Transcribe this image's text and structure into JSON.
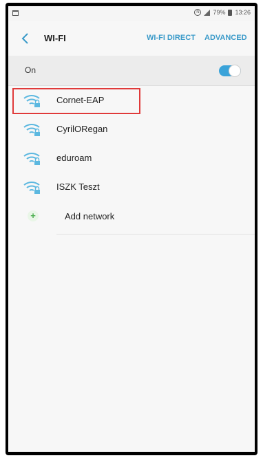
{
  "status": {
    "battery": "79%",
    "time": "13:26"
  },
  "appbar": {
    "title": "WI-FI",
    "wifi_direct": "WI-FI DIRECT",
    "advanced": "ADVANCED"
  },
  "toggle": {
    "label": "On",
    "enabled": true
  },
  "networks": [
    {
      "name": "Cornet-EAP",
      "secured": true
    },
    {
      "name": "CyrilORegan",
      "secured": true
    },
    {
      "name": "eduroam",
      "secured": true
    },
    {
      "name": "ISZK Teszt",
      "secured": true
    }
  ],
  "add_network": "Add network",
  "colors": {
    "accent": "#3a9ac9",
    "highlight": "#e03a3a",
    "toggle_on": "#3aa3d9"
  }
}
